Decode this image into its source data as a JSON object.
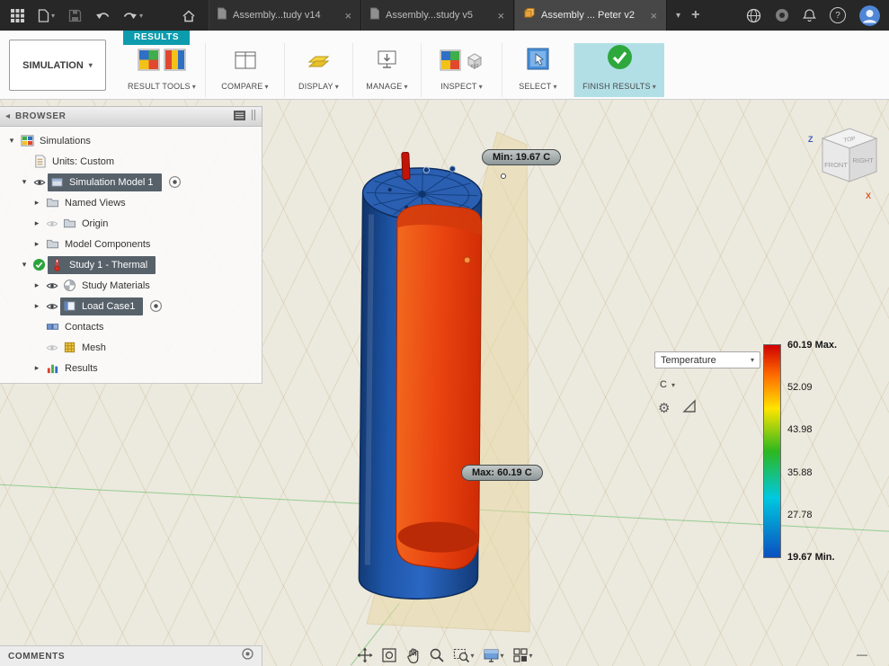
{
  "icons": {
    "close": "×",
    "caret_down": "▾",
    "expander_open": "▾",
    "expander_closed": "▸",
    "back": "◂",
    "gear": "⚙",
    "plus": "+",
    "help": "?",
    "minus": "—",
    "xyz_label": "xyz"
  },
  "titlebar": {
    "tabs": [
      {
        "label": "Assembly...tudy v14",
        "active": false
      },
      {
        "label": "Assembly...study v5",
        "active": false
      },
      {
        "label": "Assembly ... Peter v2",
        "active": true
      }
    ]
  },
  "ribbon": {
    "workspace_label": "SIMULATION",
    "tab_label": "RESULTS",
    "groups": [
      {
        "label": "RESULT TOOLS"
      },
      {
        "label": "COMPARE"
      },
      {
        "label": "DISPLAY"
      },
      {
        "label": "MANAGE"
      },
      {
        "label": "INSPECT"
      },
      {
        "label": "SELECT"
      },
      {
        "label": "FINISH RESULTS"
      }
    ]
  },
  "browser": {
    "header": "BROWSER",
    "tree": [
      {
        "label": "Simulations",
        "level": 0,
        "expander": "open",
        "pre": "none",
        "icon": "simulations",
        "selected": false,
        "radio": false
      },
      {
        "label": "Units: Custom",
        "level": 1,
        "expander": "leaf",
        "pre": "none",
        "icon": "units",
        "selected": false,
        "radio": false
      },
      {
        "label": "Simulation Model 1",
        "level": 1,
        "expander": "open",
        "pre": "eye",
        "icon": "model",
        "selected": true,
        "radio": true
      },
      {
        "label": "Named Views",
        "level": 2,
        "expander": "closed",
        "pre": "none",
        "icon": "folder",
        "selected": false,
        "radio": false
      },
      {
        "label": "Origin",
        "level": 2,
        "expander": "closed",
        "pre": "eye-off",
        "icon": "folder",
        "selected": false,
        "radio": false
      },
      {
        "label": "Model Components",
        "level": 2,
        "expander": "closed",
        "pre": "none",
        "icon": "folder",
        "selected": false,
        "radio": false
      },
      {
        "label": "Study 1 - Thermal",
        "level": 1,
        "expander": "open",
        "pre": "check",
        "icon": "thermal",
        "selected": true,
        "radio": false
      },
      {
        "label": "Study Materials",
        "level": 2,
        "expander": "closed",
        "pre": "eye",
        "icon": "materials",
        "selected": false,
        "radio": false
      },
      {
        "label": "Load Case1",
        "level": 2,
        "expander": "closed",
        "pre": "eye",
        "icon": "loadcase",
        "selected": true,
        "radio": true
      },
      {
        "label": "Contacts",
        "level": 2,
        "expander": "leaf",
        "pre": "none",
        "icon": "contacts",
        "selected": false,
        "radio": false
      },
      {
        "label": "Mesh",
        "level": 2,
        "expander": "leaf",
        "pre": "eye-off",
        "icon": "mesh",
        "selected": false,
        "radio": false
      },
      {
        "label": "Results",
        "level": 2,
        "expander": "closed",
        "pre": "none",
        "icon": "results",
        "selected": false,
        "radio": false
      }
    ]
  },
  "viewport": {
    "min_annotation": "Min: 19.67 C",
    "max_annotation": "Max: 60.19 C",
    "viewcube": {
      "top": "TOP",
      "front": "FRONT",
      "right": "RIGHT",
      "axis_z": "Z",
      "axis_x": "X"
    }
  },
  "legend": {
    "quantity": "Temperature",
    "unit": "C",
    "ticks": [
      "60.19 Max.",
      "52.09",
      "43.98",
      "35.88",
      "27.78",
      "19.67 Min."
    ],
    "colors": {
      "top": "#cf0000",
      "mid": "#2db81e",
      "bottom": "#0a4fc0"
    }
  },
  "comments": {
    "label": "COMMENTS"
  }
}
